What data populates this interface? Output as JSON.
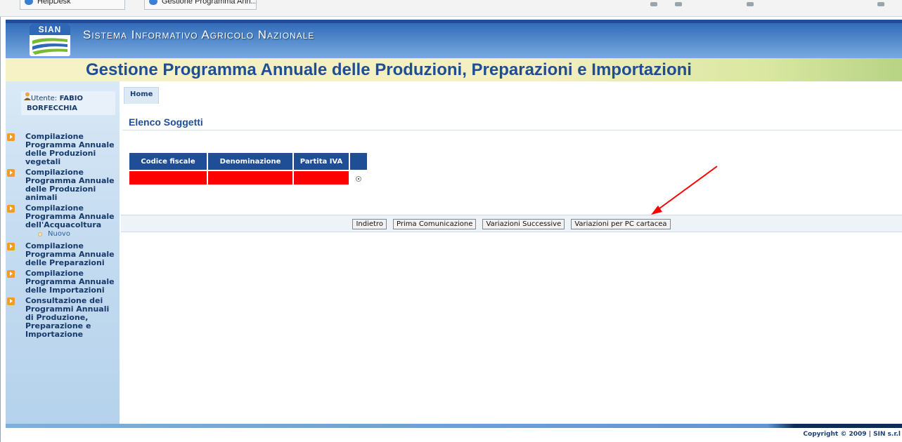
{
  "browser": {
    "tabs": [
      {
        "label": "HelpDesk"
      },
      {
        "label": "Gestione Programma Ann..."
      }
    ]
  },
  "header": {
    "logo_text": "SIAN",
    "site_name": "Sistema Informativo Agricolo Nazionale",
    "app_title": "Gestione Programma Annuale delle Produzioni, Preparazioni e Importazioni"
  },
  "sidebar": {
    "user_label": "Utente:",
    "user_name_line1": "FABIO",
    "user_name_line2": "BORFECCHIA",
    "menu": [
      {
        "label": "Compilazione Programma Annuale delle Produzioni vegetali"
      },
      {
        "label": "Compilazione Programma Annuale delle Produzioni animali"
      },
      {
        "label": "Compilazione Programma Annuale dell'Acquacoltura"
      },
      {
        "label": "Compilazione Programma Annuale delle Preparazioni"
      },
      {
        "label": "Compilazione Programma Annuale delle Importazioni"
      },
      {
        "label": "Consultazione dei Programmi Annuali di Produzione, Preparazione e Importazione"
      }
    ],
    "submenu_nuovo": "Nuovo"
  },
  "main": {
    "breadcrumb_home": "Home",
    "section_title": "Elenco Soggetti",
    "table": {
      "headers": [
        "Codice fiscale",
        "Denominazione",
        "Partita IVA",
        ""
      ],
      "rows": [
        {
          "codice_fiscale": "",
          "denominazione": "",
          "partita_iva": "",
          "selected": true
        }
      ]
    },
    "buttons": {
      "indietro": "Indietro",
      "prima": "Prima Comunicazione",
      "variazioni_successive": "Variazioni Successive",
      "variazioni_pc": "Variazioni per PC cartacea"
    }
  },
  "footer": {
    "copyright": "Copyright © 2009 | SIN s.r.l"
  },
  "colors": {
    "accent": "#1f4e96",
    "menu_arrow": "#f39c23",
    "redaction": "#ff0000"
  }
}
